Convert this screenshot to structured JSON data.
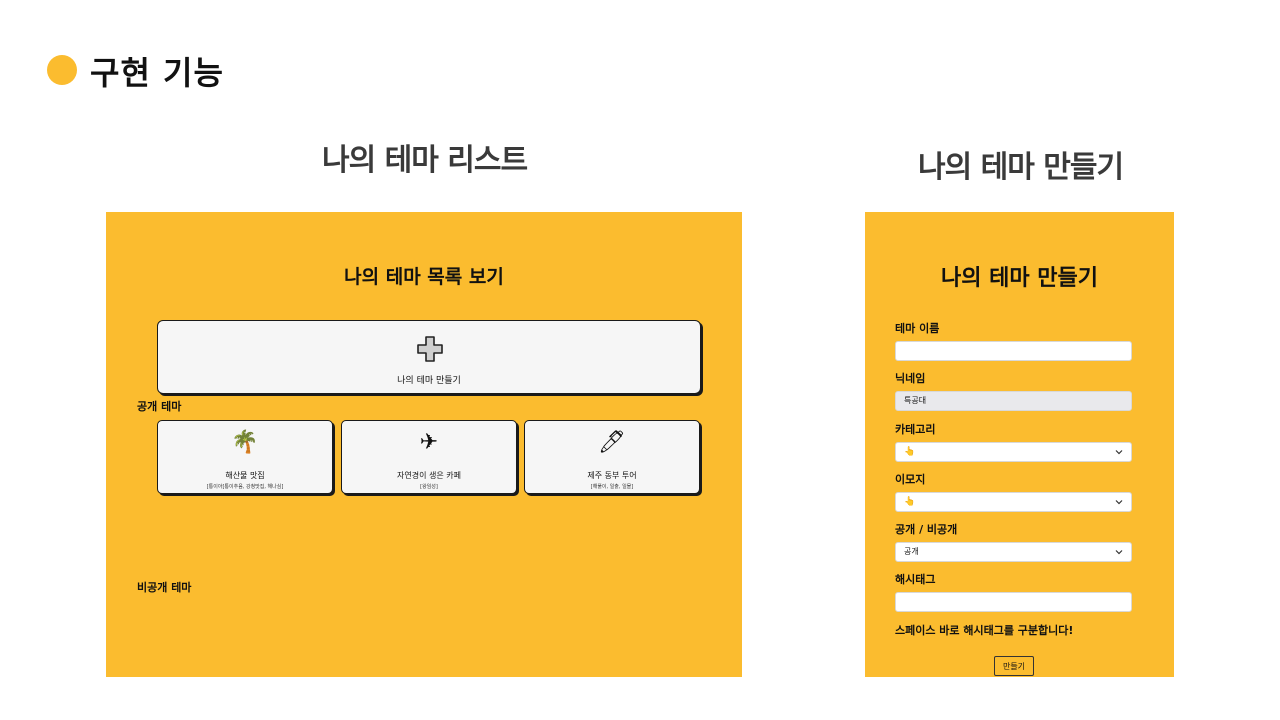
{
  "slide": {
    "title": "구현 기능",
    "left_heading": "나의 테마 리스트",
    "right_heading": "나의 테마 만들기"
  },
  "theme_list": {
    "title": "나의 테마 목록 보기",
    "create_label": "나의 테마 만들기",
    "public_label": "공개 테마",
    "private_label": "비공개 테마",
    "cards": [
      {
        "icon": "🌴",
        "icon_name": "palm-tree-icon",
        "name": "해산물 맛집",
        "tags": "[통이아[통이추음, 강청맛집, 해나심]"
      },
      {
        "icon": "✈",
        "icon_name": "airplane-icon",
        "name": "자연경이 생은 카페",
        "tags": "[왕임성]"
      },
      {
        "icon": "🖊",
        "icon_name": "pen-icon",
        "name": "제주 동부 투어",
        "tags": "[해풀이, 일출, 일몰]"
      }
    ]
  },
  "theme_form": {
    "title": "나의 테마 만들기",
    "name_label": "테마 이름",
    "name_value": "",
    "nickname_label": "닉네임",
    "nickname_value": "특공대",
    "category_label": "카테고리",
    "category_value": "👆",
    "emoji_label": "이모지",
    "emoji_value": "👆",
    "visibility_label": "공개 / 비공개",
    "visibility_value": "공개",
    "hashtag_label": "해시태그",
    "hashtag_value": "",
    "hint": "스페이스 바로 해시태그를 구분합니다!",
    "submit_label": "만들기"
  },
  "colors": {
    "accent": "#FBBC2F",
    "card": "#F6F6F6"
  }
}
